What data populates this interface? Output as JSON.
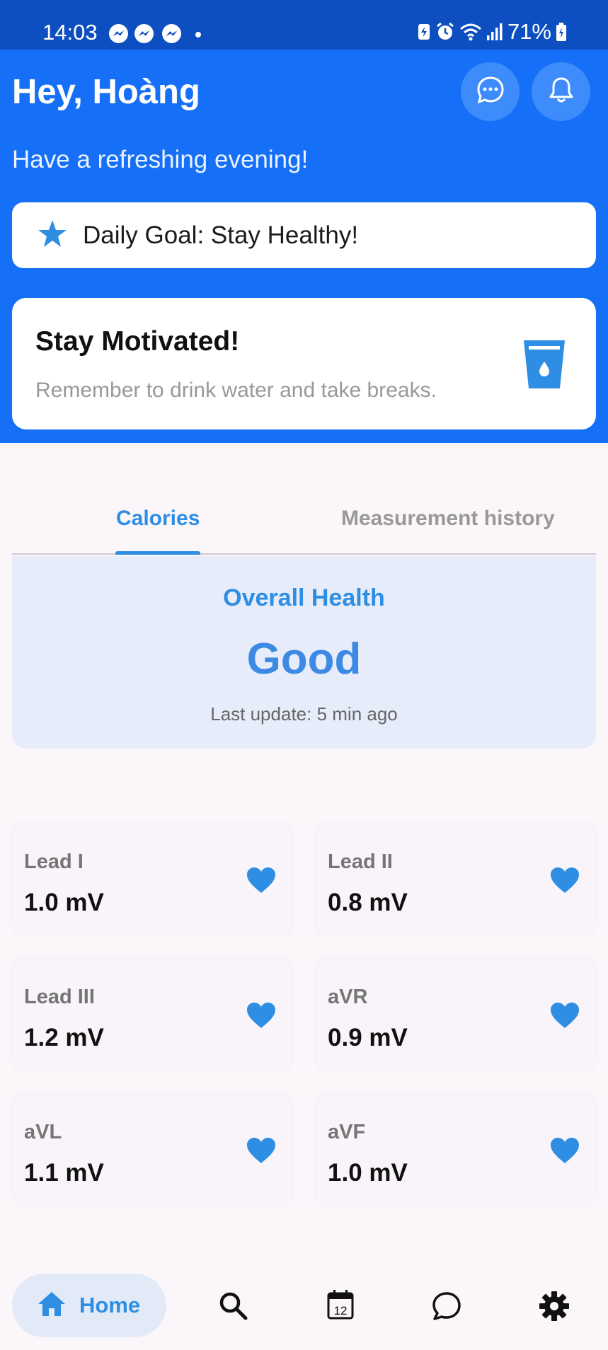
{
  "status_bar": {
    "time": "14:03",
    "battery": "71%",
    "notification_icons": [
      "messenger-icon",
      "messenger-icon",
      "messenger-icon"
    ],
    "system_icons": [
      "battery-saver-icon",
      "alarm-icon",
      "wifi-icon",
      "signal-icon",
      "battery-icon"
    ]
  },
  "header": {
    "greeting": "Hey, Hoàng",
    "subtitle": "Have a refreshing evening!",
    "actions": [
      "chat-icon",
      "bell-icon"
    ]
  },
  "goal": {
    "text": "Daily Goal: Stay Healthy!",
    "icon": "star-icon"
  },
  "motivation": {
    "title": "Stay Motivated!",
    "text": "Remember to drink water and take breaks.",
    "icon": "water-glass-icon"
  },
  "tabs": {
    "items": [
      {
        "label": "Calories",
        "active": true
      },
      {
        "label": "Measurement history",
        "active": false
      }
    ]
  },
  "health": {
    "title": "Overall Health",
    "status": "Good",
    "last_update": "Last update: 5 min ago"
  },
  "leads": [
    {
      "name": "Lead I",
      "value": "1.0 mV"
    },
    {
      "name": "Lead II",
      "value": "0.8 mV"
    },
    {
      "name": "Lead III",
      "value": "1.2 mV"
    },
    {
      "name": "aVR",
      "value": "0.9 mV"
    },
    {
      "name": "aVL",
      "value": "1.1 mV"
    },
    {
      "name": "aVF",
      "value": "1.0 mV"
    }
  ],
  "bottom_nav": {
    "home_label": "Home",
    "calendar_day": "12",
    "items": [
      "home-icon",
      "search-icon",
      "calendar-icon",
      "chat-icon",
      "settings-icon"
    ]
  },
  "colors": {
    "primary": "#156ff7",
    "accent": "#2d8ee3",
    "status_bar": "#0d4fc0",
    "background": "#fbf6fa",
    "health_card": "#e7ecfa"
  }
}
